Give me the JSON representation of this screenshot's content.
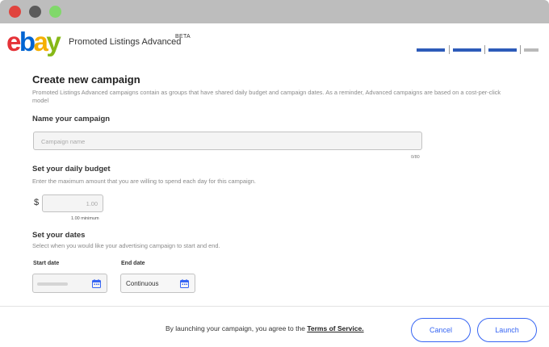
{
  "window": {
    "controls": [
      "close",
      "minimize",
      "maximize"
    ]
  },
  "header": {
    "logo_letters": [
      "e",
      "b",
      "a",
      "y"
    ],
    "product_name": "Promoted Listings Advanced",
    "badge": "BETA",
    "progress_steps": [
      {
        "state": "complete"
      },
      {
        "state": "complete"
      },
      {
        "state": "complete"
      },
      {
        "state": "incomplete"
      }
    ]
  },
  "page": {
    "title": "Create new campaign",
    "intro": "Promoted Listings Advanced campaigns contain as groups that have shared daily budget and campaign dates. As a reminder, Advanced campaigns are based on a cost-per-click model"
  },
  "name_section": {
    "title": "Name your campaign",
    "placeholder": "Campaign name",
    "counter": "0/80"
  },
  "budget_section": {
    "title": "Set your daily budget",
    "helper": "Enter the maximum amount that you are willing to spend each day for this campaign.",
    "currency": "$",
    "placeholder": "1.00",
    "minimum": "1.00 minimum"
  },
  "dates_section": {
    "title": "Set your dates",
    "helper": "Select when you would like your advertising campaign to start and end.",
    "start_label": "Start date",
    "end_label": "End date",
    "end_value": "Continuous",
    "icon": "calendar-icon"
  },
  "footer": {
    "terms_prefix": "By launching your campaign, you agree to the",
    "terms_link": "Terms of Service.",
    "cancel_label": "Cancel",
    "launch_label": "Launch"
  },
  "colors": {
    "logo_e": "#e53238",
    "logo_b": "#0064d2",
    "logo_a": "#f5af02",
    "logo_y": "#86b817",
    "step_complete": "#2d5bb9",
    "step_incomplete": "#b9b9b9",
    "button_accent": "#3665f3"
  }
}
